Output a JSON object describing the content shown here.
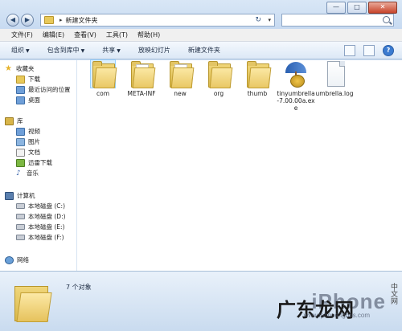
{
  "address": {
    "crumb": "新建文件夹",
    "separator": "▸"
  },
  "search": {
    "placeholder": ""
  },
  "window_controls": {
    "minimize": "—",
    "maximize": "□",
    "close": "✕"
  },
  "menu": [
    "文件(F)",
    "编辑(E)",
    "查看(V)",
    "工具(T)",
    "帮助(H)"
  ],
  "toolbar": {
    "organize": "组织",
    "include_library": "包含到库中",
    "share": "共享",
    "slideshow": "放映幻灯片",
    "new_folder": "新建文件夹"
  },
  "nav": {
    "favorites": "收藏夹",
    "downloads": "下载",
    "recent": "最近访问的位置",
    "desktop": "桌面",
    "library": "库",
    "videos": "视频",
    "pictures": "图片",
    "documents": "文档",
    "thunder": "迅雷下载",
    "music": "音乐",
    "computer": "计算机",
    "drive_c": "本地磁盘 (C:)",
    "drive_d": "本地磁盘 (D:)",
    "drive_e": "本地磁盘 (E:)",
    "drive_f": "本地磁盘 (F:)",
    "network": "网络"
  },
  "files": [
    {
      "name": "com",
      "type": "folder"
    },
    {
      "name": "META-INF",
      "type": "folder"
    },
    {
      "name": "new",
      "type": "folder"
    },
    {
      "name": "org",
      "type": "folder"
    },
    {
      "name": "thumb",
      "type": "folder"
    },
    {
      "name": "tinyumbrella-7.00.00a.exe",
      "type": "exe"
    },
    {
      "name": "umbrella.log",
      "type": "document"
    }
  ],
  "details": {
    "count": "7 个对象"
  },
  "watermark": {
    "brand": "iPhone",
    "site": "www.iphone.tgbus.com",
    "cn": "广东龙网",
    "side": "中文网"
  },
  "colors": {
    "accent": "#cfe0f3",
    "folder": "#e8c95a"
  }
}
